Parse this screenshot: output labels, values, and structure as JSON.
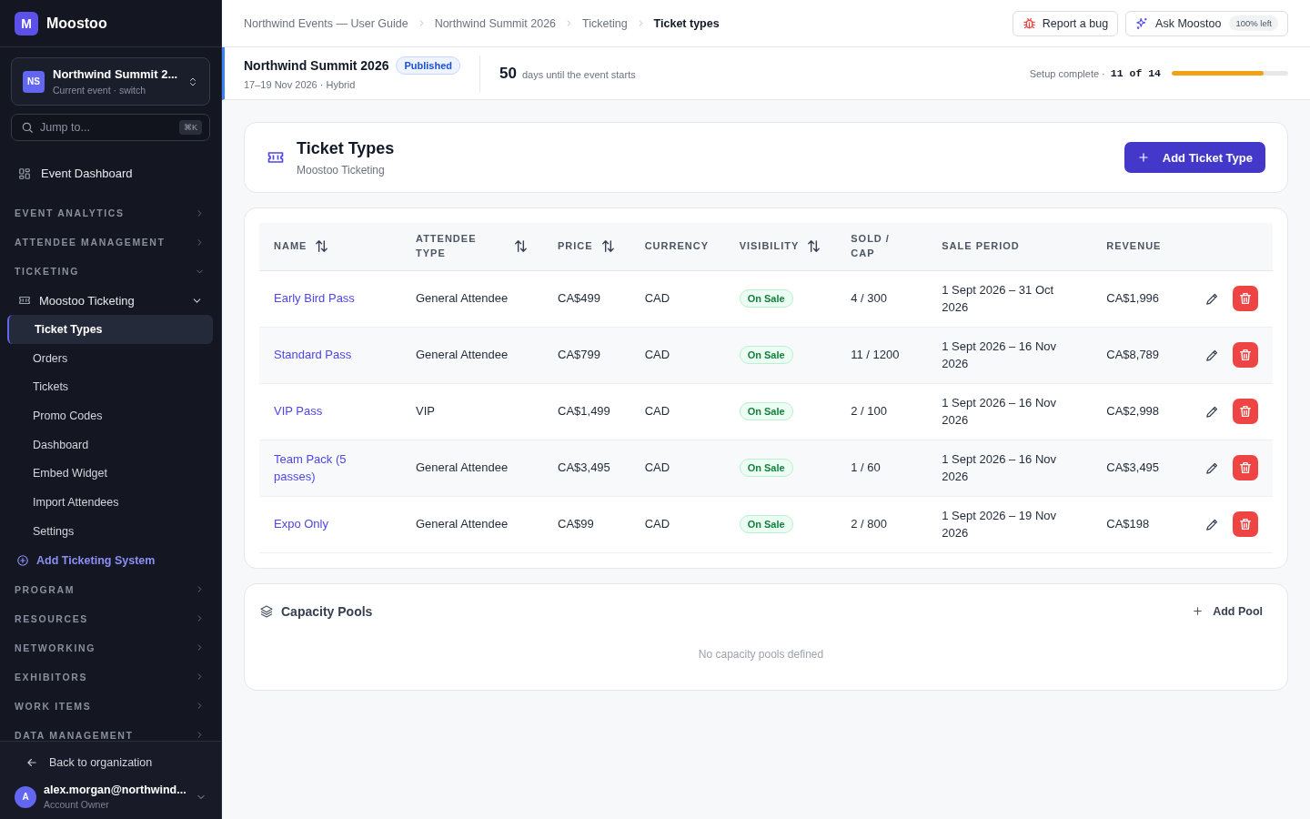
{
  "app": {
    "logo_letter": "M",
    "name": "Moostoo"
  },
  "event_switcher": {
    "initials": "NS",
    "name": "Northwind Summit 2...",
    "subtitle": "Current event · switch"
  },
  "search": {
    "placeholder": "Jump to...",
    "shortcut": "⌘K"
  },
  "sidebar": {
    "items": [
      {
        "kind": "link",
        "label": "Event Dashboard"
      },
      {
        "kind": "section",
        "label": "EVENT ANALYTICS",
        "expanded": false
      },
      {
        "kind": "section",
        "label": "ATTENDEE MANAGEMENT",
        "expanded": false
      },
      {
        "kind": "section",
        "label": "TICKETING",
        "expanded": true
      },
      {
        "kind": "group",
        "label": "Moostoo Ticketing",
        "expanded": true,
        "children": [
          {
            "label": "Ticket Types",
            "selected": true
          },
          {
            "label": "Orders",
            "selected": false
          },
          {
            "label": "Tickets",
            "selected": false
          },
          {
            "label": "Promo Codes",
            "selected": false
          },
          {
            "label": "Dashboard",
            "selected": false
          },
          {
            "label": "Embed Widget",
            "selected": false
          },
          {
            "label": "Import Attendees",
            "selected": false
          },
          {
            "label": "Settings",
            "selected": false
          }
        ]
      },
      {
        "kind": "add",
        "label": "Add Ticketing System"
      },
      {
        "kind": "section",
        "label": "PROGRAM",
        "expanded": false
      },
      {
        "kind": "section",
        "label": "RESOURCES",
        "expanded": false
      },
      {
        "kind": "section",
        "label": "NETWORKING",
        "expanded": false
      },
      {
        "kind": "section",
        "label": "EXHIBITORS",
        "expanded": false
      },
      {
        "kind": "section",
        "label": "WORK ITEMS",
        "expanded": false
      },
      {
        "kind": "section",
        "label": "DATA MANAGEMENT",
        "expanded": false
      }
    ]
  },
  "sidebar_footer": {
    "back": "Back to organization",
    "user": {
      "initial": "A",
      "email": "alex.morgan@northwind...",
      "role": "Account Owner"
    }
  },
  "breadcrumbs": [
    {
      "label": "Northwind Events — User Guide",
      "current": false
    },
    {
      "label": "Northwind Summit 2026",
      "current": false
    },
    {
      "label": "Ticketing",
      "current": false
    },
    {
      "label": "Ticket types",
      "current": true
    }
  ],
  "header_buttons": {
    "report": "Report a bug",
    "ask": "Ask Moostoo",
    "ask_badge": "100% left"
  },
  "event_bar": {
    "name": "Northwind Summit 2026",
    "status": "Published",
    "dates": "17–19 Nov 2026 · Hybrid",
    "days": "50",
    "days_label": "days until the event starts",
    "setup_label": "Setup complete ·",
    "setup_count": "11 of 14",
    "setup": {
      "level": 0.786
    }
  },
  "page_header": {
    "title": "Ticket Types",
    "subtitle": "Moostoo Ticketing",
    "add_button": "Add Ticket Type"
  },
  "table": {
    "columns": [
      {
        "label": "NAME",
        "sortable": true
      },
      {
        "label": "ATTENDEE TYPE",
        "sortable": true
      },
      {
        "label": "PRICE",
        "sortable": true
      },
      {
        "label": "CURRENCY",
        "sortable": false
      },
      {
        "label": "VISIBILITY",
        "sortable": true
      },
      {
        "label": "SOLD / CAP",
        "sortable": false
      },
      {
        "label": "SALE PERIOD",
        "sortable": false
      },
      {
        "label": "REVENUE",
        "sortable": false
      }
    ],
    "rows": [
      {
        "name": "Early Bird Pass",
        "attendee_type": "General Attendee",
        "price": "CA$499",
        "currency": "CAD",
        "visibility": "On Sale",
        "sold_cap": "4 / 300",
        "sale_period": "1 Sept 2026 – 31 Oct 2026",
        "revenue": "CA$1,996"
      },
      {
        "name": "Standard Pass",
        "attendee_type": "General Attendee",
        "price": "CA$799",
        "currency": "CAD",
        "visibility": "On Sale",
        "sold_cap": "11 / 1200",
        "sale_period": "1 Sept 2026 – 16 Nov 2026",
        "revenue": "CA$8,789"
      },
      {
        "name": "VIP Pass",
        "attendee_type": "VIP",
        "price": "CA$1,499",
        "currency": "CAD",
        "visibility": "On Sale",
        "sold_cap": "2 / 100",
        "sale_period": "1 Sept 2026 – 16 Nov 2026",
        "revenue": "CA$2,998"
      },
      {
        "name": "Team Pack (5 passes)",
        "attendee_type": "General Attendee",
        "price": "CA$3,495",
        "currency": "CAD",
        "visibility": "On Sale",
        "sold_cap": "1 / 60",
        "sale_period": "1 Sept 2026 – 16 Nov 2026",
        "revenue": "CA$3,495"
      },
      {
        "name": "Expo Only",
        "attendee_type": "General Attendee",
        "price": "CA$99",
        "currency": "CAD",
        "visibility": "On Sale",
        "sold_cap": "2 / 800",
        "sale_period": "1 Sept 2026 – 19 Nov 2026",
        "revenue": "CA$198"
      }
    ]
  },
  "capacity_pools": {
    "title": "Capacity Pools",
    "add_button": "Add Pool",
    "empty": "No capacity pools defined"
  }
}
